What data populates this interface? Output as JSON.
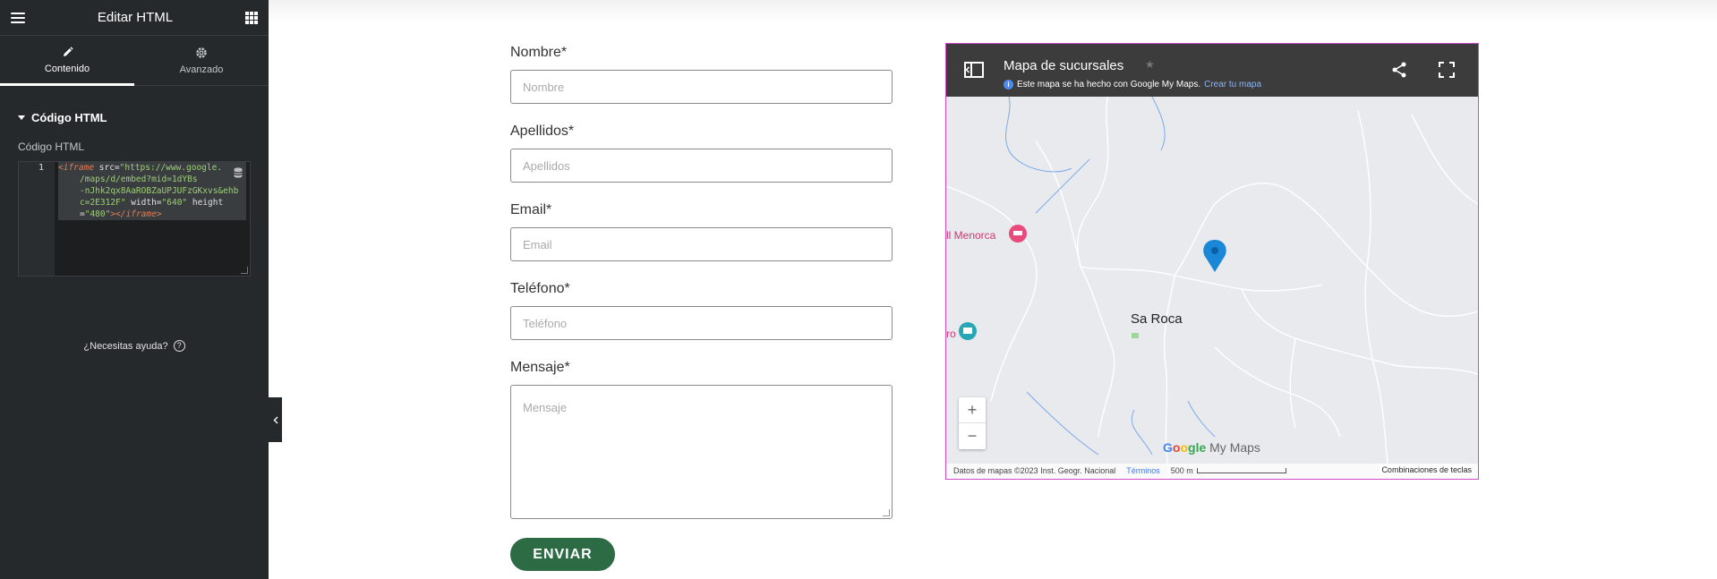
{
  "sidebar": {
    "title": "Editar HTML",
    "tabs": [
      {
        "label": "Contenido",
        "icon": "pencil-icon"
      },
      {
        "label": "Avanzado",
        "icon": "gear-icon"
      }
    ],
    "section_title": "Código HTML",
    "field_label": "Código HTML",
    "code": {
      "line_number": "1",
      "l1_tag": "<iframe",
      "l1_attr": " src=",
      "l1_str": "\"https://www.google.",
      "l2_str": "/maps/d/embed?mid=1dYBs",
      "l3_str": "-nJhk2qx8AaROBZaUPJUFzGKxvs&ehb",
      "l4_str": "c=2E312F\"",
      "l4_attr": " width=",
      "l4_str2": "\"640\"",
      "l4_attr2": " height",
      "l5_attr": "=",
      "l5_str": "\"480\"",
      "l5_tag": "></iframe>"
    },
    "help": "¿Necesitas ayuda?",
    "help_icon": "?"
  },
  "form": {
    "fields": [
      {
        "label": "Nombre*",
        "placeholder": "Nombre"
      },
      {
        "label": "Apellidos*",
        "placeholder": "Apellidos"
      },
      {
        "label": "Email*",
        "placeholder": "Email"
      },
      {
        "label": "Teléfono*",
        "placeholder": "Teléfono"
      }
    ],
    "message_label": "Mensaje*",
    "message_placeholder": "Mensaje",
    "submit": "ENVIAR",
    "submit_color": "#2d6b45"
  },
  "map": {
    "title": "Mapa de sucursales",
    "star": "★",
    "info_icon": "i",
    "subtitle": "Este mapa se ha hecho con Google My Maps.",
    "create_link": "Crear tu mapa",
    "places": {
      "hotel": "ll Menorca",
      "town": "Sa Roca",
      "ro": "ro"
    },
    "zoom_in": "+",
    "zoom_out": "−",
    "logo": {
      "g1": "G",
      "g2": "o",
      "g3": "o",
      "g4": "gle",
      "mm": " My Maps"
    },
    "attribution": "Datos de mapas ©2023 Inst. Geogr. Nacional",
    "terms": "Términos",
    "scale": "500 m",
    "keyboard": "Combinaciones de teclas"
  }
}
